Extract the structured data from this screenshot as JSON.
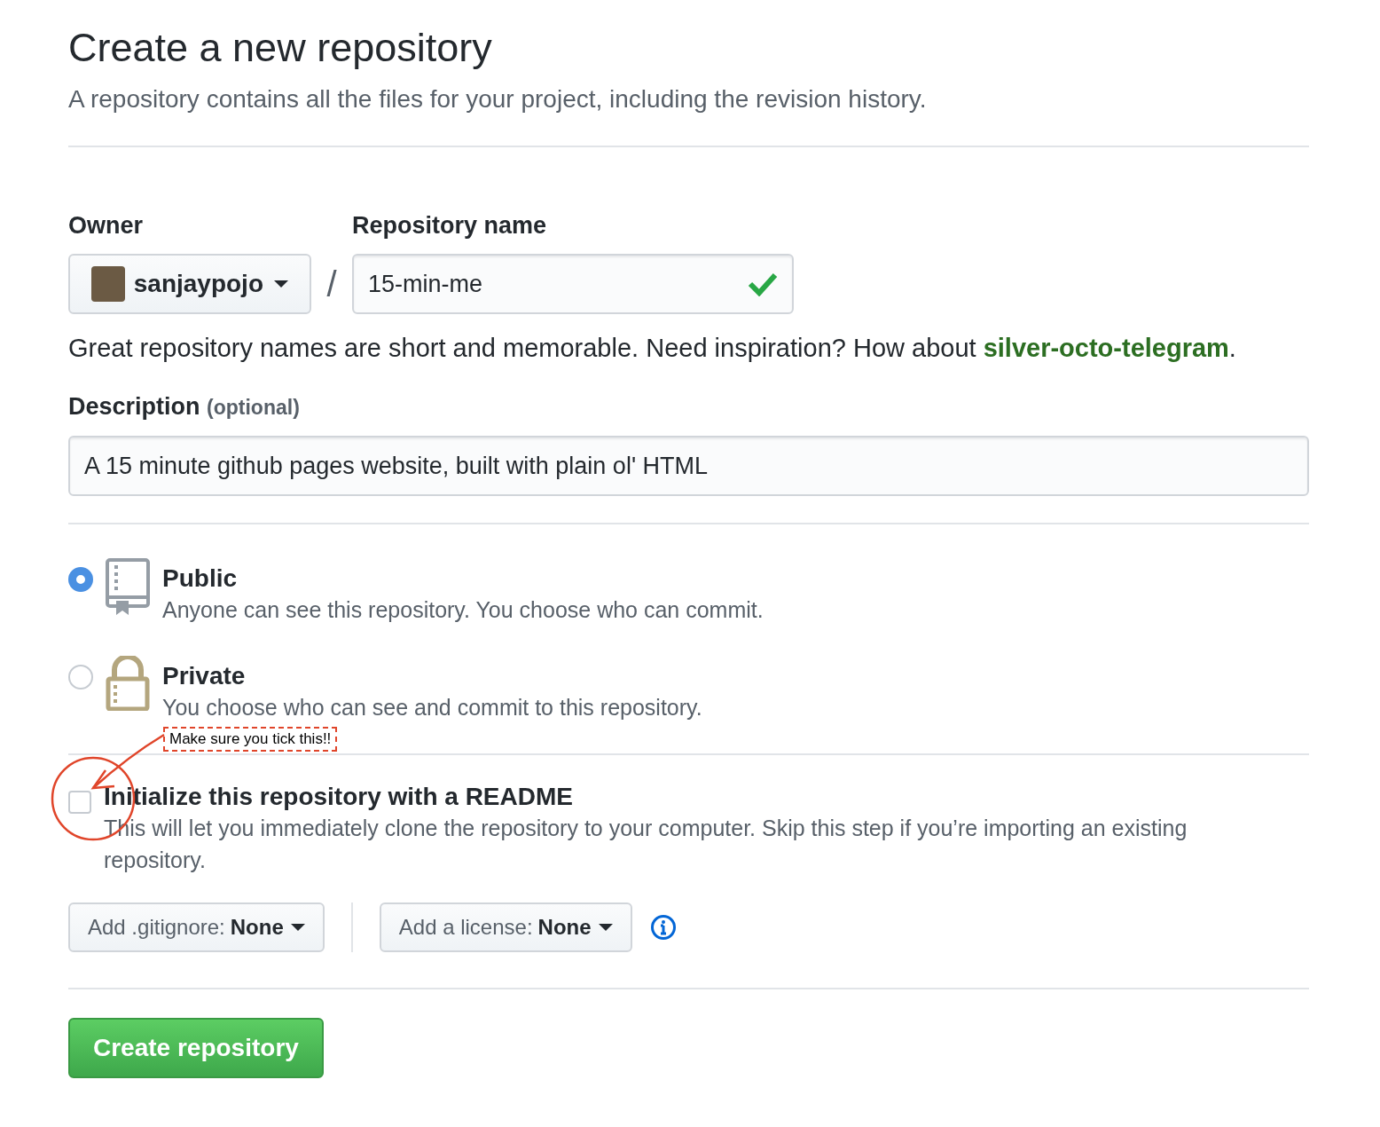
{
  "page": {
    "title": "Create a new repository",
    "subtitle": "A repository contains all the files for your project, including the revision history."
  },
  "owner": {
    "label": "Owner",
    "value": "sanjaypojo"
  },
  "separator": "/",
  "repository_name": {
    "label": "Repository name",
    "value": "15-min-me",
    "valid": true
  },
  "name_hint": {
    "text": "Great repository names are short and memorable. Need inspiration? How about",
    "suggestion": "silver-octo-telegram",
    "end": "."
  },
  "description": {
    "label": "Description",
    "optional": "(optional)",
    "value": "A 15 minute github pages website, built with plain ol' HTML"
  },
  "visibility": [
    {
      "kind": "public",
      "label": "Public",
      "description": "Anyone can see this repository. You choose who can commit.",
      "selected": true
    },
    {
      "kind": "private",
      "label": "Private",
      "description": "You choose who can see and commit to this repository.",
      "selected": false
    }
  ],
  "readme": {
    "label": "Initialize this repository with a README",
    "description": "This will let you immediately clone the repository to your computer. Skip this step if you’re importing an existing repository.",
    "checked": false
  },
  "gitignore": {
    "label": "Add .gitignore:",
    "value": "None"
  },
  "license": {
    "label": "Add a license:",
    "value": "None"
  },
  "submit": "Create repository",
  "annotation": {
    "note": "Make sure you tick this!!"
  }
}
